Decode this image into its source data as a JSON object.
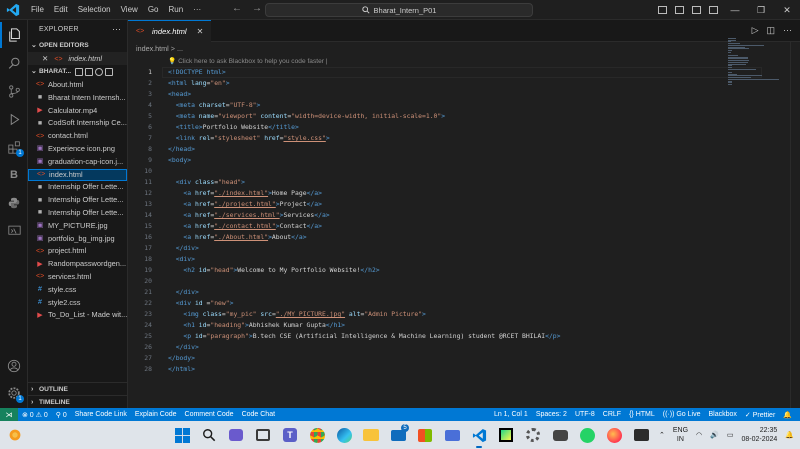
{
  "titlebar": {
    "menus": [
      "File",
      "Edit",
      "Selection",
      "View",
      "Go",
      "Run",
      "···"
    ],
    "search_text": "Bharat_Intern_P01"
  },
  "sidebar": {
    "title": "EXPLORER",
    "open_editors_label": "OPEN EDITORS",
    "open_editor_file": "index.html",
    "project_label": "BHARAT...",
    "files": [
      {
        "name": "About.html",
        "type": "html"
      },
      {
        "name": "Bharat Intern Internsh...",
        "type": "pdf"
      },
      {
        "name": "Calculator.mp4",
        "type": "video"
      },
      {
        "name": "CodSoft Internship Ce...",
        "type": "pdf"
      },
      {
        "name": "contact.html",
        "type": "html"
      },
      {
        "name": "Experience icon.png",
        "type": "image"
      },
      {
        "name": "graduation-cap-icon.j...",
        "type": "image"
      },
      {
        "name": "index.html",
        "type": "html"
      },
      {
        "name": "Internship Offer Lette...",
        "type": "pdf"
      },
      {
        "name": "Internship Offer Lette...",
        "type": "pdf"
      },
      {
        "name": "Internship Offer Lette...",
        "type": "pdf"
      },
      {
        "name": "MY_PICTURE.jpg",
        "type": "image"
      },
      {
        "name": "portfolio_bg_img.jpg",
        "type": "image"
      },
      {
        "name": "project.html",
        "type": "html"
      },
      {
        "name": "Randompasswordgen...",
        "type": "video"
      },
      {
        "name": "services.html",
        "type": "html"
      },
      {
        "name": "style.css",
        "type": "css"
      },
      {
        "name": "style2.css",
        "type": "css"
      },
      {
        "name": "To_Do_List - Made wit...",
        "type": "video"
      }
    ],
    "outline_label": "OUTLINE",
    "timeline_label": "TIMELINE"
  },
  "editor": {
    "tab_label": "index.html",
    "breadcrumb": "index.html > ...",
    "hint": "Click here to ask Blackbox to help you code faster |",
    "lines": [
      [
        [
          "tag",
          "<!DOCTYPE html>"
        ]
      ],
      [
        [
          "tag",
          "<html "
        ],
        [
          "attr",
          "lang"
        ],
        [
          "txt",
          "="
        ],
        [
          "str",
          "\"en\""
        ],
        [
          "tag",
          ">"
        ]
      ],
      [
        [
          "tag",
          "<head>"
        ]
      ],
      [
        [
          "txt",
          "  "
        ],
        [
          "tag",
          "<meta "
        ],
        [
          "attr",
          "charset"
        ],
        [
          "txt",
          "="
        ],
        [
          "str",
          "\"UTF-8\""
        ],
        [
          "tag",
          ">"
        ]
      ],
      [
        [
          "txt",
          "  "
        ],
        [
          "tag",
          "<meta "
        ],
        [
          "attr",
          "name"
        ],
        [
          "txt",
          "="
        ],
        [
          "str",
          "\"viewport\""
        ],
        [
          "txt",
          " "
        ],
        [
          "attr",
          "content"
        ],
        [
          "txt",
          "="
        ],
        [
          "str",
          "\"width=device-width, initial-scale=1.0\""
        ],
        [
          "tag",
          ">"
        ]
      ],
      [
        [
          "txt",
          "  "
        ],
        [
          "tag",
          "<title>"
        ],
        [
          "txt",
          "Portfolio Website"
        ],
        [
          "tag",
          "</title>"
        ]
      ],
      [
        [
          "txt",
          "  "
        ],
        [
          "tag",
          "<link "
        ],
        [
          "attr",
          "rel"
        ],
        [
          "txt",
          "="
        ],
        [
          "str",
          "\"stylesheet\""
        ],
        [
          "txt",
          " "
        ],
        [
          "attr",
          "href"
        ],
        [
          "txt",
          "="
        ],
        [
          "strl",
          "\"style.css\""
        ],
        [
          "tag",
          ">"
        ]
      ],
      [
        [
          "tag",
          "</head>"
        ]
      ],
      [
        [
          "tag",
          "<body>"
        ]
      ],
      [],
      [
        [
          "txt",
          "  "
        ],
        [
          "tag",
          "<div "
        ],
        [
          "attr",
          "class"
        ],
        [
          "txt",
          "="
        ],
        [
          "str",
          "\"head\""
        ],
        [
          "tag",
          ">"
        ]
      ],
      [
        [
          "txt",
          "    "
        ],
        [
          "tag",
          "<a "
        ],
        [
          "attr",
          "href"
        ],
        [
          "txt",
          "="
        ],
        [
          "strl",
          "\"./index.html\""
        ],
        [
          "tag",
          ">"
        ],
        [
          "txt",
          "Home Page"
        ],
        [
          "tag",
          "</a>"
        ]
      ],
      [
        [
          "txt",
          "    "
        ],
        [
          "tag",
          "<a "
        ],
        [
          "attr",
          "href"
        ],
        [
          "txt",
          "="
        ],
        [
          "strl",
          "\"./project.html\""
        ],
        [
          "tag",
          ">"
        ],
        [
          "txt",
          "Project"
        ],
        [
          "tag",
          "</a>"
        ]
      ],
      [
        [
          "txt",
          "    "
        ],
        [
          "tag",
          "<a "
        ],
        [
          "attr",
          "href"
        ],
        [
          "txt",
          "="
        ],
        [
          "strl",
          "\"./services.html\""
        ],
        [
          "tag",
          ">"
        ],
        [
          "txt",
          "Services"
        ],
        [
          "tag",
          "</a>"
        ]
      ],
      [
        [
          "txt",
          "    "
        ],
        [
          "tag",
          "<a "
        ],
        [
          "attr",
          "href"
        ],
        [
          "txt",
          "="
        ],
        [
          "strl",
          "\"./contact.html\""
        ],
        [
          "tag",
          ">"
        ],
        [
          "txt",
          "Contact"
        ],
        [
          "tag",
          "</a>"
        ]
      ],
      [
        [
          "txt",
          "    "
        ],
        [
          "tag",
          "<a "
        ],
        [
          "attr",
          "href"
        ],
        [
          "txt",
          "="
        ],
        [
          "strl",
          "\"./About.html\""
        ],
        [
          "tag",
          ">"
        ],
        [
          "txt",
          "About"
        ],
        [
          "tag",
          "</a>"
        ]
      ],
      [
        [
          "txt",
          "  "
        ],
        [
          "tag",
          "</div>"
        ]
      ],
      [
        [
          "txt",
          "  "
        ],
        [
          "tag",
          "<div>"
        ]
      ],
      [
        [
          "txt",
          "    "
        ],
        [
          "tag",
          "<h2 "
        ],
        [
          "attr",
          "id"
        ],
        [
          "txt",
          "="
        ],
        [
          "str",
          "\"head\""
        ],
        [
          "tag",
          ">"
        ],
        [
          "txt",
          "Welcome to My Portfolio Website!"
        ],
        [
          "tag",
          "</h2>"
        ]
      ],
      [],
      [
        [
          "txt",
          "  "
        ],
        [
          "tag",
          "</div>"
        ]
      ],
      [
        [
          "txt",
          "  "
        ],
        [
          "tag",
          "<div "
        ],
        [
          "attr",
          "id"
        ],
        [
          "txt",
          " ="
        ],
        [
          "str",
          "\"new\""
        ],
        [
          "tag",
          ">"
        ]
      ],
      [
        [
          "txt",
          "    "
        ],
        [
          "tag",
          "<img "
        ],
        [
          "attr",
          "class"
        ],
        [
          "txt",
          "="
        ],
        [
          "str",
          "\"my_pic\""
        ],
        [
          "txt",
          " "
        ],
        [
          "attr",
          "src"
        ],
        [
          "txt",
          "="
        ],
        [
          "strl",
          "\"./MY_PICTURE.jpg\""
        ],
        [
          "txt",
          " "
        ],
        [
          "attr",
          "alt"
        ],
        [
          "txt",
          "="
        ],
        [
          "str",
          "\"Admin Picture\""
        ],
        [
          "tag",
          ">"
        ]
      ],
      [
        [
          "txt",
          "    "
        ],
        [
          "tag",
          "<h1 "
        ],
        [
          "attr",
          "id"
        ],
        [
          "txt",
          "="
        ],
        [
          "str",
          "\"heading\""
        ],
        [
          "tag",
          ">"
        ],
        [
          "txt",
          "Abhishek Kumar Gupta"
        ],
        [
          "tag",
          "</h1>"
        ]
      ],
      [
        [
          "txt",
          "    "
        ],
        [
          "tag",
          "<p "
        ],
        [
          "attr",
          "id"
        ],
        [
          "txt",
          "="
        ],
        [
          "str",
          "\"paragraph\""
        ],
        [
          "tag",
          ">"
        ],
        [
          "txt",
          "B.tech CSE (Artificial Intelligence & Machine Learning) student @RCET BHILAI"
        ],
        [
          "tag",
          "</p>"
        ]
      ],
      [
        [
          "txt",
          "  "
        ],
        [
          "tag",
          "</div>"
        ]
      ],
      [
        [
          "tag",
          "</body>"
        ]
      ],
      [
        [
          "tag",
          "</html>"
        ]
      ]
    ]
  },
  "statusbar": {
    "left": [
      "⊗ 0 ⚠ 0",
      "⚲ 0",
      "Share Code Link",
      "Explain Code",
      "Comment Code",
      "Code Chat"
    ],
    "right": [
      "Ln 1, Col 1",
      "Spaces: 2",
      "UTF-8",
      "CRLF",
      "{} HTML",
      "((·)) Go Live",
      "Blackbox",
      "✓ Prettier"
    ]
  },
  "taskbar": {
    "lang": "ENG",
    "region": "IN",
    "time": "22:35",
    "date": "08-02-2024",
    "mail_badge": "5"
  },
  "colors": {
    "accent": "#0078d4",
    "status_bar": "#0078d4",
    "remote": "#16825d",
    "tag": "#569cd6",
    "attribute": "#9cdcfe",
    "string": "#ce9178"
  }
}
